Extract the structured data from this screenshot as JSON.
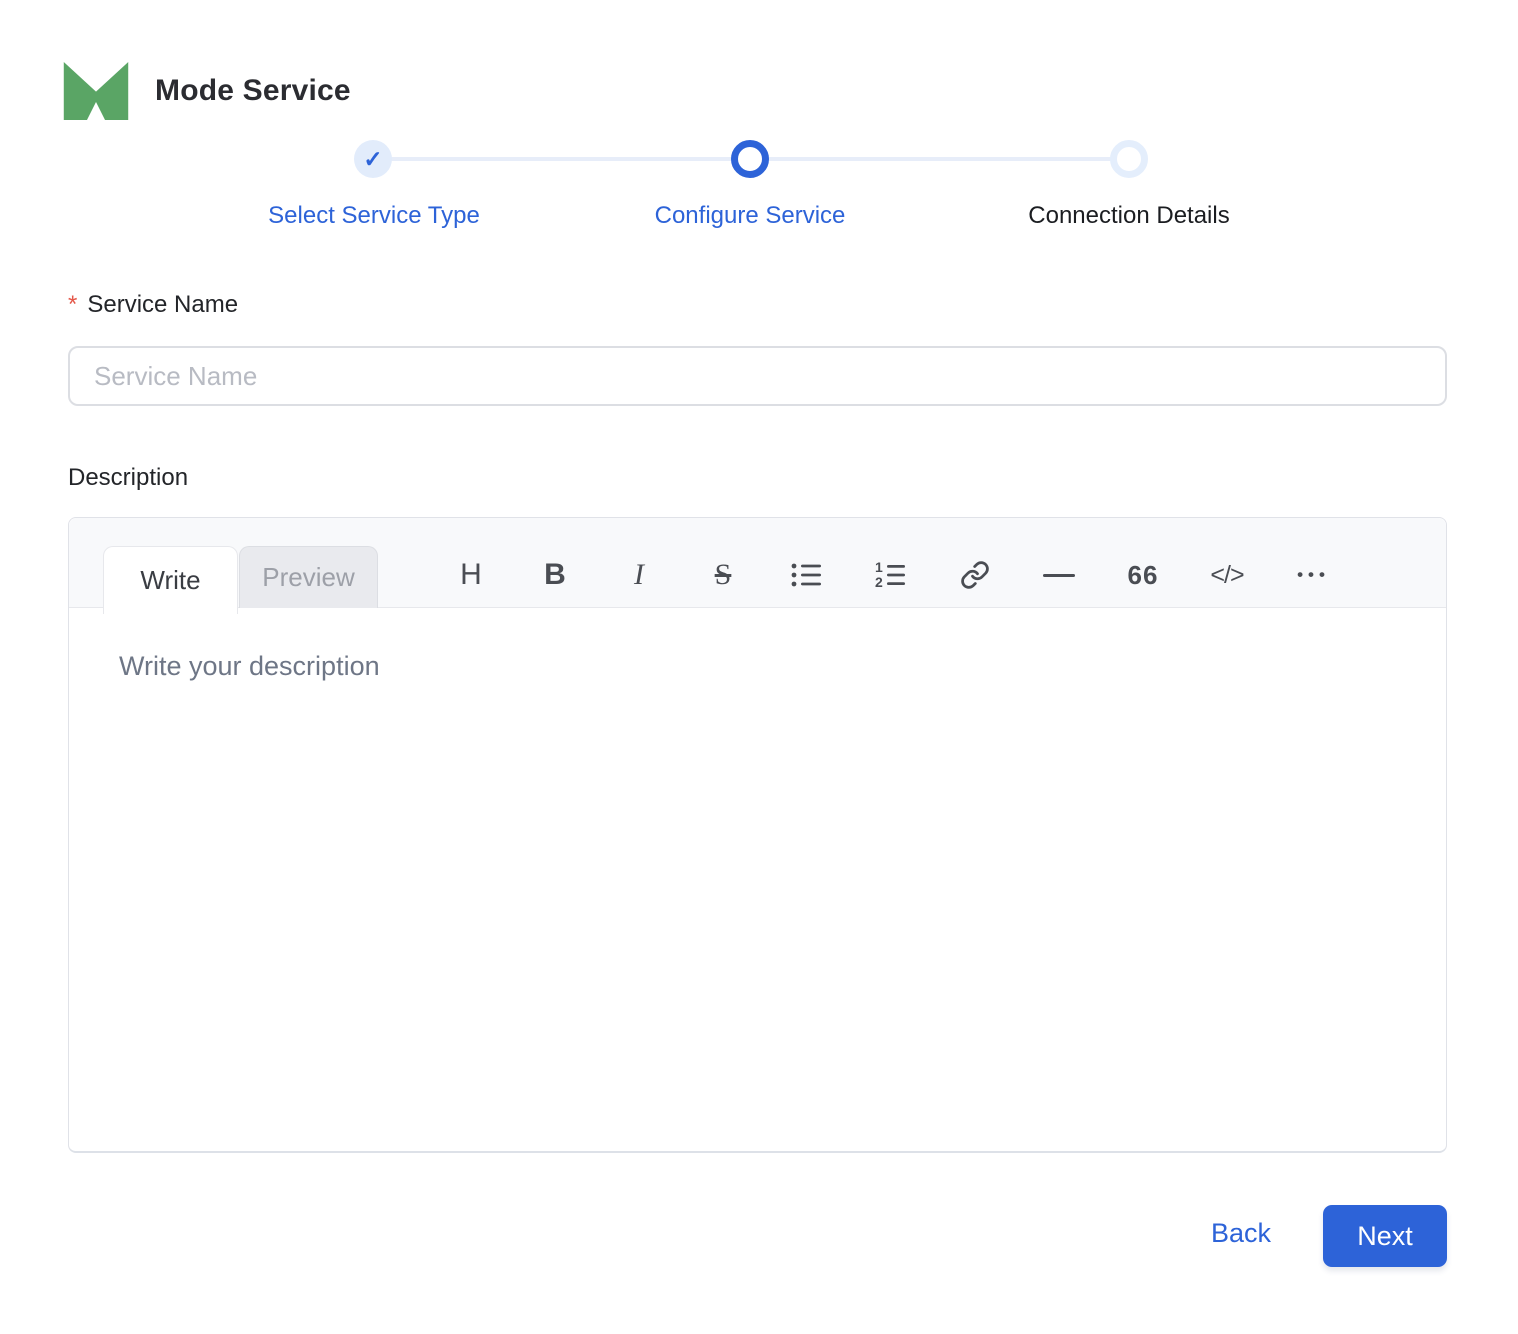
{
  "header": {
    "app_title": "Mode Service"
  },
  "stepper": {
    "steps": [
      {
        "label": "Select Service Type",
        "state": "completed"
      },
      {
        "label": "Configure Service",
        "state": "current"
      },
      {
        "label": "Connection Details",
        "state": "upcoming"
      }
    ],
    "check_glyph": "✓"
  },
  "form": {
    "service_name": {
      "required_marker": "*",
      "label": "Service Name",
      "placeholder": "Service Name",
      "value": ""
    },
    "description": {
      "label": "Description",
      "tabs": [
        {
          "label": "Write",
          "active": true
        },
        {
          "label": "Preview",
          "active": false
        }
      ],
      "toolbar": {
        "heading": "H",
        "bold": "B",
        "italic": "I",
        "strikethrough": "S",
        "quote": "66",
        "code": "</>",
        "more": "•••"
      },
      "toolbar_icons": [
        "heading-icon",
        "bold-icon",
        "italic-icon",
        "strikethrough-icon",
        "bullet-list-icon",
        "numbered-list-icon",
        "link-icon",
        "horizontal-rule-icon",
        "quote-icon",
        "code-icon",
        "more-icon"
      ],
      "placeholder": "Write your description",
      "value": ""
    }
  },
  "footer": {
    "back_label": "Back",
    "next_label": "Next"
  },
  "colors": {
    "accent_blue": "#2d63d8",
    "logo_green": "#5aa565",
    "required_red": "#e45749",
    "step_inactive": "#e4eefc"
  }
}
